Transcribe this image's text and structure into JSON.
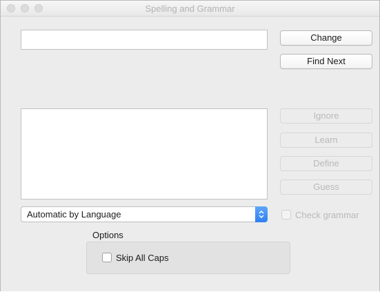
{
  "window": {
    "title": "Spelling and Grammar"
  },
  "word_field": {
    "value": ""
  },
  "buttons": {
    "change": "Change",
    "find_next": "Find Next",
    "ignore": "Ignore",
    "learn": "Learn",
    "define": "Define",
    "guess": "Guess"
  },
  "suggestions": [],
  "language_popup": {
    "selected": "Automatic by Language"
  },
  "check_grammar": {
    "label": "Check grammar",
    "checked": false,
    "enabled": false
  },
  "options": {
    "title": "Options",
    "skip_all_caps": {
      "label": "Skip All Caps",
      "checked": false
    }
  },
  "colors": {
    "accent": "#2f7ff2",
    "disabled_text": "#b9b9b9"
  }
}
